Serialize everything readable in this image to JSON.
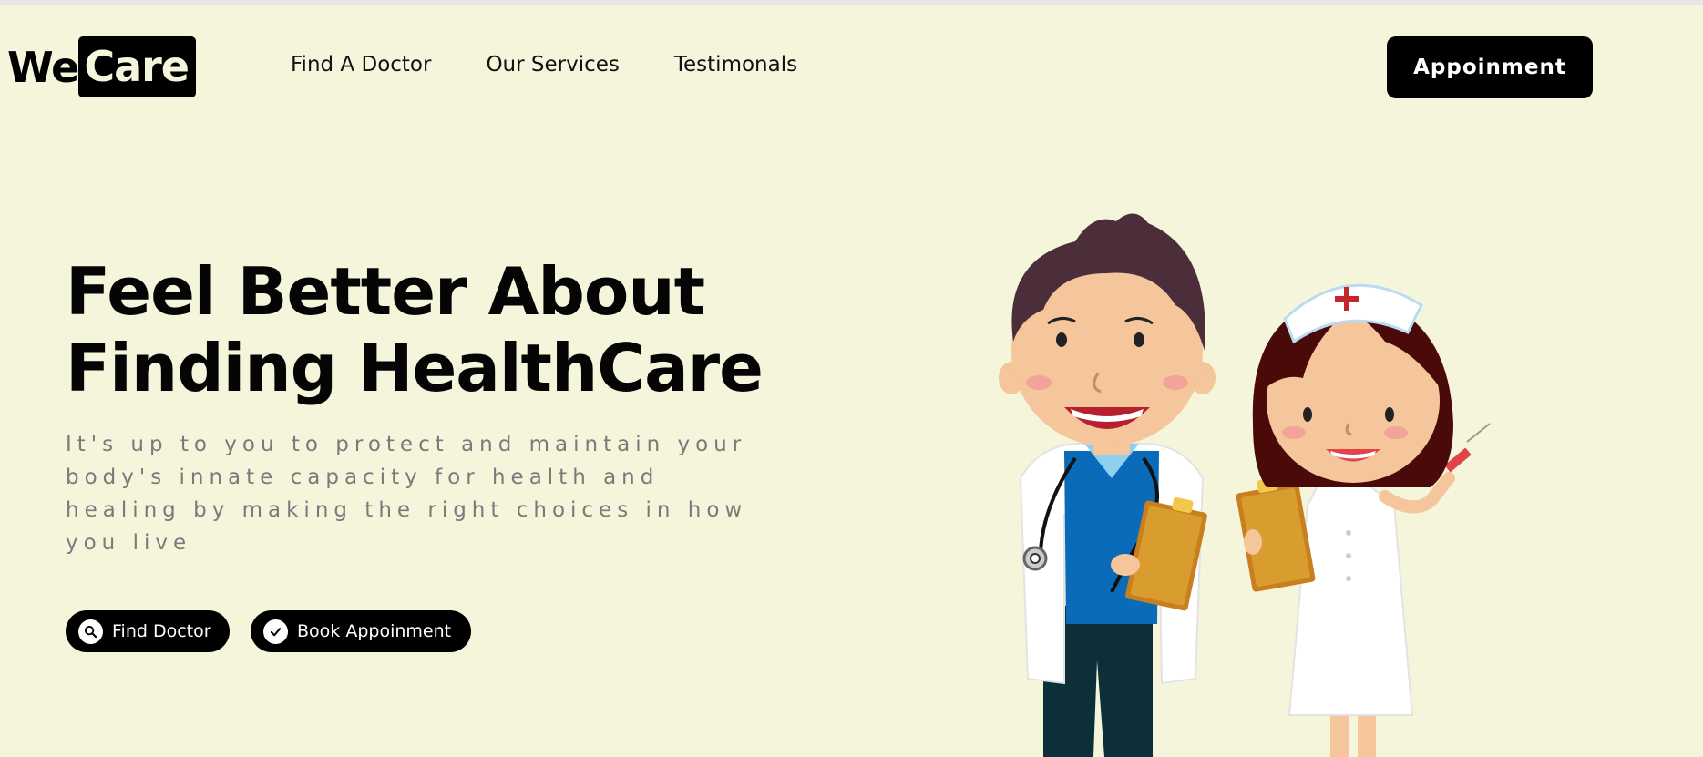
{
  "header": {
    "logo": {
      "part1": "We",
      "part2": "Care"
    },
    "nav": [
      "Find A Doctor",
      "Our Services",
      "Testimonals"
    ],
    "cta_label": "Appoinment"
  },
  "hero": {
    "title_line1": "Feel Better About",
    "title_line2": "Finding HealthCare",
    "subtitle": "It's up to you to protect and maintain your body's innate capacity for health and healing by making the right choices in how you live",
    "buttons": [
      {
        "label": "Find Doctor",
        "icon": "search-icon"
      },
      {
        "label": "Book Appoinment",
        "icon": "check-icon"
      }
    ]
  },
  "illustration": {
    "subject": "doctor-and-nurse-cartoon"
  },
  "colors": {
    "background": "#f5f5dc",
    "primary": "#000000",
    "text_muted": "#7a7a7a"
  }
}
